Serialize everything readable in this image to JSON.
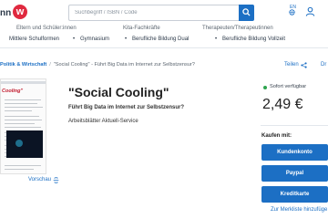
{
  "header": {
    "brand_text": "nn",
    "logo_letter": "w",
    "search_placeholder": "Suchbegriff / ISBN / Code",
    "language": "EN"
  },
  "nav": {
    "row1": [
      "Eltern und Schüler:innen",
      "Kita-Fachkräfte",
      "Therapeuten/Therapeutinnen"
    ],
    "row2": [
      "Mittlere Schulformen",
      "Gymnasium",
      "Berufliche Bildung Dual",
      "Berufliche Bildung Vollzeit"
    ]
  },
  "breadcrumb": {
    "parent": "Politik & Wirtschaft",
    "current": "\"Social Cooling\" - Führt Big Data im Internet zur Selbstzensur?"
  },
  "actions": {
    "share": "Teilen",
    "print": "Dr"
  },
  "cover": {
    "title": "Cooling\""
  },
  "preview": {
    "label": "Vorschau"
  },
  "product": {
    "title": "\"Social Cooling\"",
    "subtitle": "Führt Big Data im Internet zur Selbstzensur?",
    "series": "Arbeitsblätter Aktuell-Service"
  },
  "purchase": {
    "availability": "Sofort verfügbar",
    "price": "2,49 €",
    "buy_label": "Kaufen mit:",
    "buttons": [
      "Kundenkonto",
      "Paypal",
      "Kreditkarte"
    ],
    "wishlist": "Zur Merkliste hinzufüge"
  },
  "colors": {
    "accent": "#1c6fc4",
    "brand": "#e0293f",
    "status": "#2ea44f"
  }
}
